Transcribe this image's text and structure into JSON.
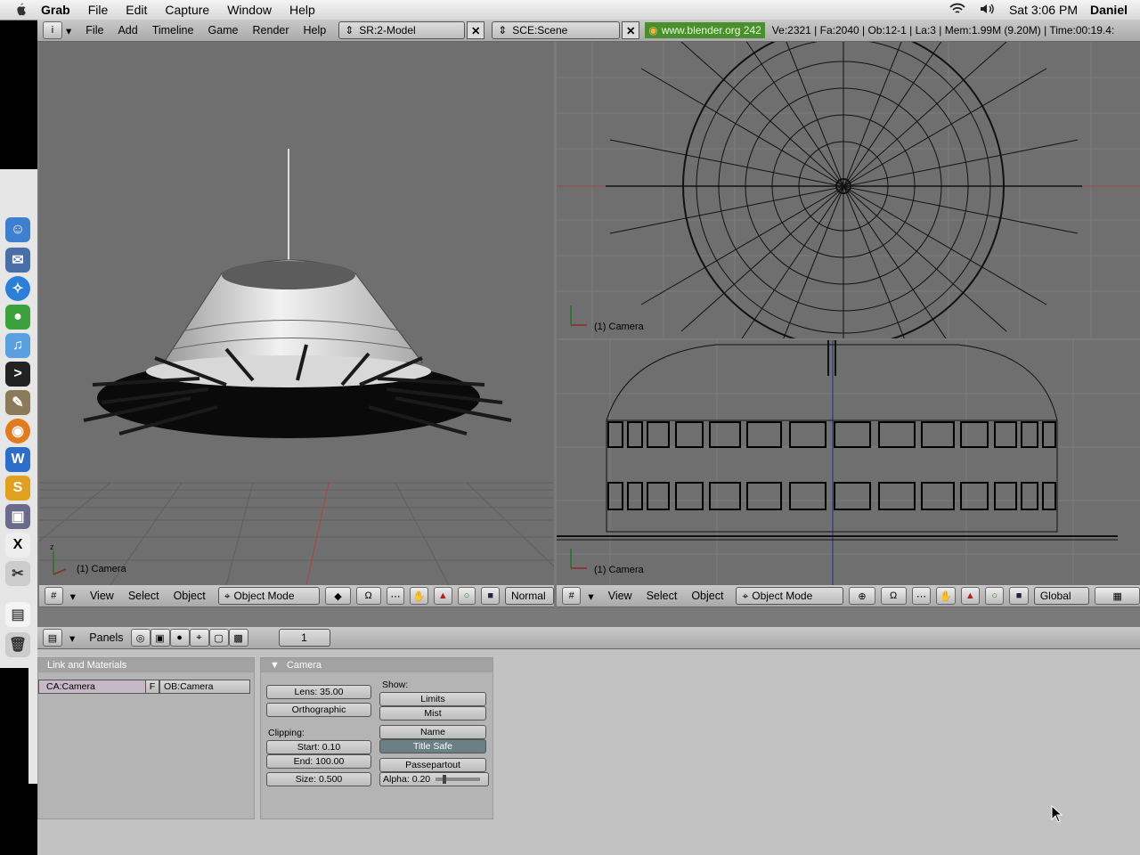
{
  "menubar": {
    "app": "Grab",
    "items": [
      "File",
      "Edit",
      "Capture",
      "Window",
      "Help"
    ],
    "clock": "Sat 3:06 PM",
    "user": "Daniel"
  },
  "top_header": {
    "menus": [
      "File",
      "Add",
      "Timeline",
      "Game",
      "Render",
      "Help"
    ],
    "screen_field": "SR:2-Model",
    "scene_field": "SCE:Scene",
    "website": "www.blender.org 242",
    "stats": "Ve:2321 | Fa:2040 | Ob:12-1 | La:3  | Mem:1.99M (9.20M)  | Time:00:19.4:"
  },
  "viewports": {
    "left_label": "(1) Camera",
    "top_right_label": "(1) Camera",
    "bottom_right_label": "(1) Camera"
  },
  "left_view_header": {
    "menus": [
      "View",
      "Select",
      "Object"
    ],
    "mode": "Object Mode",
    "shading": "Normal"
  },
  "right_view_header": {
    "menus": [
      "View",
      "Select",
      "Object"
    ],
    "mode": "Object Mode",
    "orientation": "Global"
  },
  "buttons_header": {
    "panels_label": "Panels",
    "frame": "1"
  },
  "link_panel": {
    "title": "Link and Materials",
    "camera_field": "CA:Camera",
    "f_button": "F",
    "object_field": "OB:Camera"
  },
  "camera_panel": {
    "title": "Camera",
    "lens": "Lens: 35.00",
    "orthographic": "Orthographic",
    "clipping_label": "Clipping:",
    "start": "Start: 0.10",
    "end": "End: 100.00",
    "size": "Size: 0.500",
    "show_label": "Show:",
    "limits": "Limits",
    "mist": "Mist",
    "name": "Name",
    "title_safe": "Title Safe",
    "passepartout": "Passepartout",
    "alpha": "Alpha: 0.20"
  },
  "colors": {
    "viewport_bg": "#6f6f6f",
    "header_bg": "#b0b0b0",
    "buttons_bg": "#c2c2c2",
    "website_green": "#4a8f2e"
  }
}
